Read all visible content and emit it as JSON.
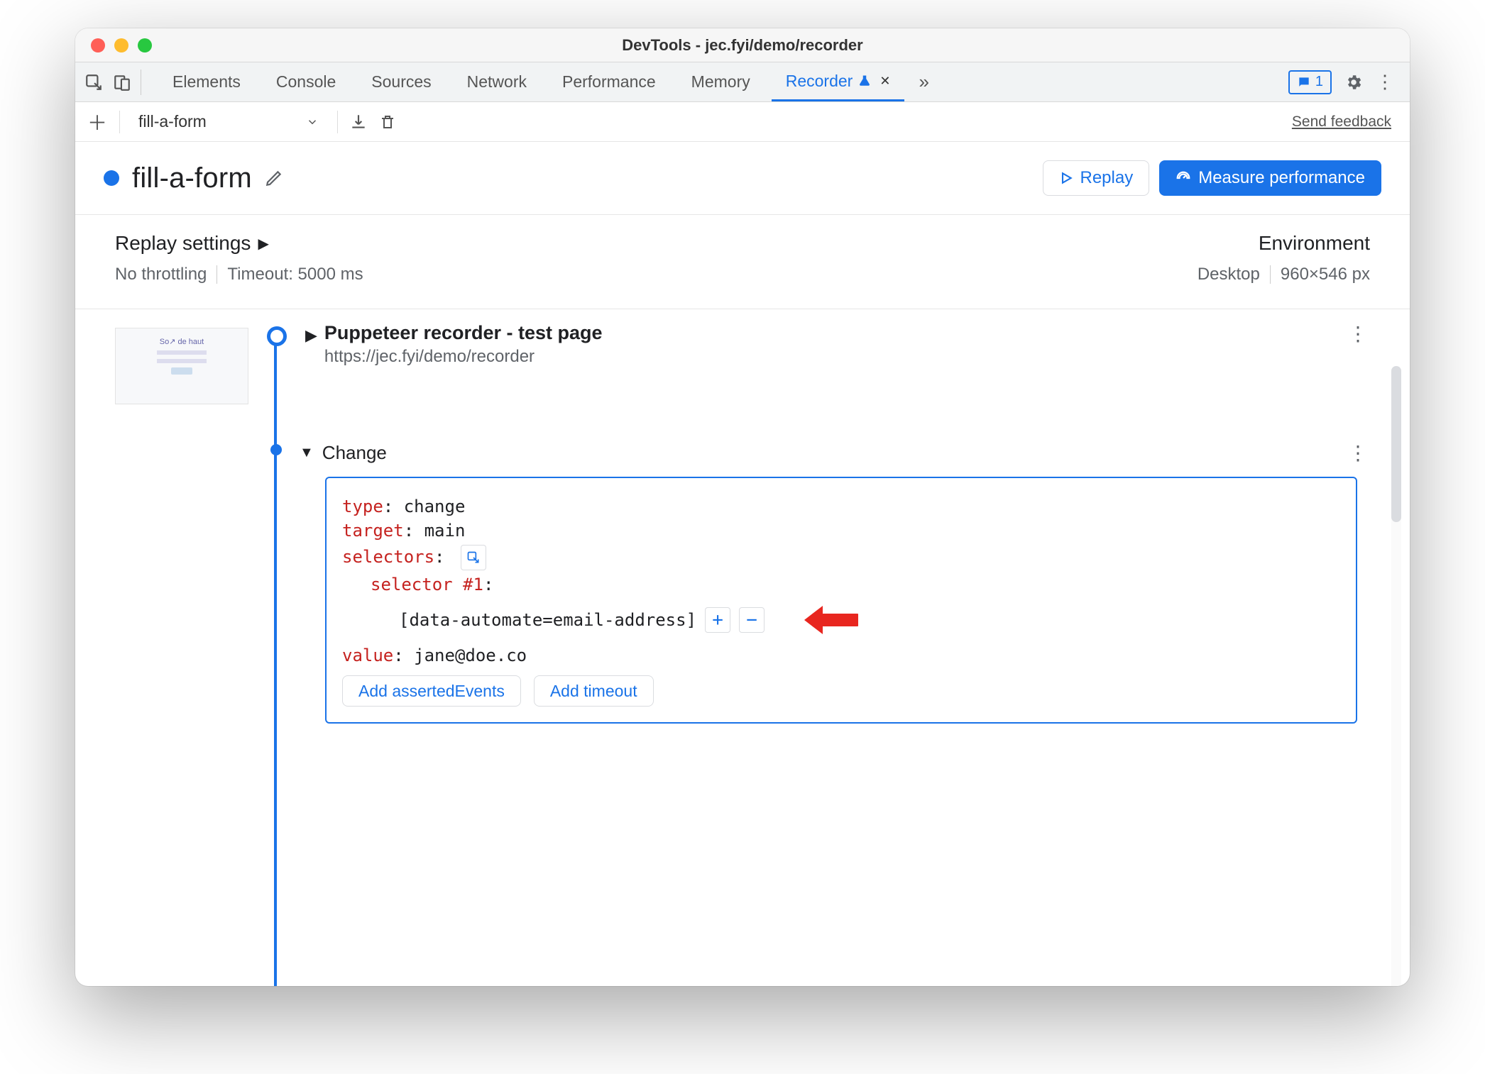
{
  "window": {
    "title": "DevTools - jec.fyi/demo/recorder"
  },
  "tabs": {
    "items": [
      "Elements",
      "Console",
      "Sources",
      "Network",
      "Performance",
      "Memory",
      "Recorder"
    ],
    "active": "Recorder",
    "badge_count": "1"
  },
  "toolbar": {
    "recording_name": "fill-a-form",
    "feedback": "Send feedback"
  },
  "recHeader": {
    "title": "fill-a-form",
    "replay": "Replay",
    "measure": "Measure performance"
  },
  "settings": {
    "replay_title": "Replay settings",
    "throttling": "No throttling",
    "timeout": "Timeout: 5000 ms",
    "env_title": "Environment",
    "device": "Desktop",
    "dims": "960×546 px"
  },
  "step_initial": {
    "title": "Puppeteer recorder - test page",
    "url": "https://jec.fyi/demo/recorder"
  },
  "step_change": {
    "label": "Change",
    "type_k": "type",
    "type_v": "change",
    "target_k": "target",
    "target_v": "main",
    "selectors_k": "selectors",
    "selector_n": "selector #1",
    "selector_val": "[data-automate=email-address]",
    "value_k": "value",
    "value_v": "jane@doe.co",
    "add_asserted": "Add assertedEvents",
    "add_timeout": "Add timeout"
  }
}
